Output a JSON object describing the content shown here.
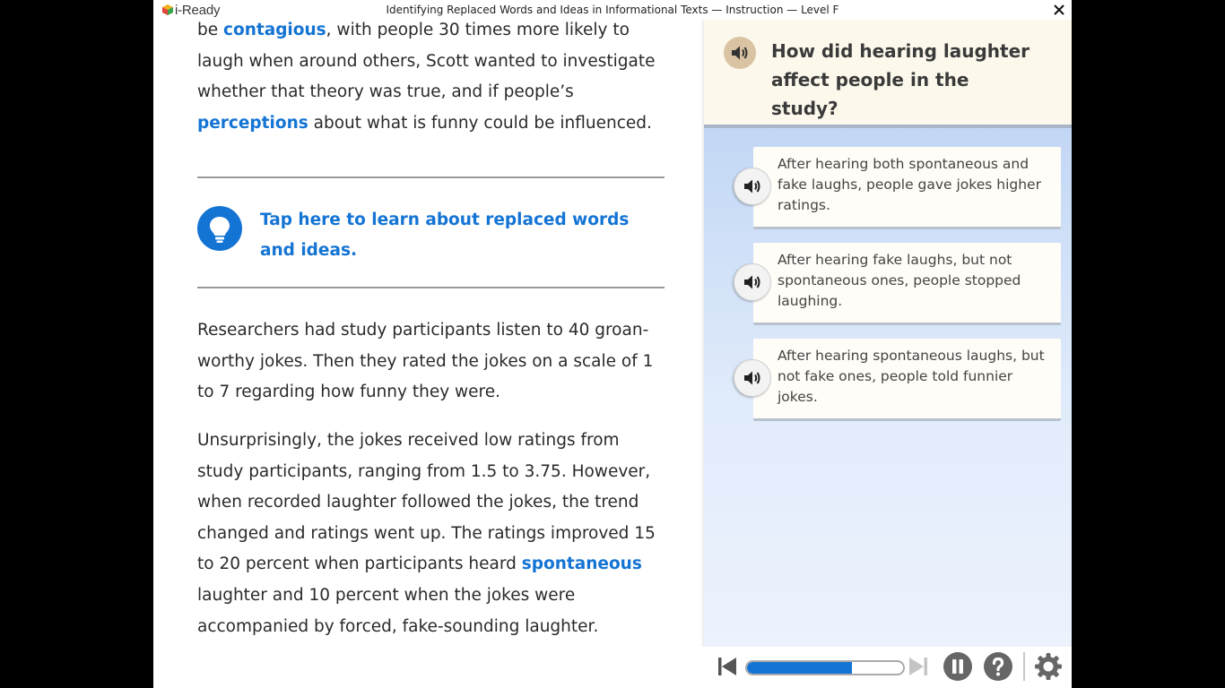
{
  "window": {
    "brand": "i-Ready",
    "title": "Identifying Replaced Words and Ideas in Informational Texts — Instruction — Level F"
  },
  "passage": {
    "p1": {
      "s1": "be ",
      "k1": "contagious",
      "s2": ", with people 30 times more likely to laugh when around others, Scott wanted to investigate whether that theory was true, and if people’s ",
      "k2": "perceptions",
      "s3": " about what is funny could be influenced."
    },
    "tip": "Tap here to learn about replaced words and ideas.",
    "p2": "Researchers had study participants listen to 40 groan-worthy jokes. Then they rated the jokes on a scale of 1 to 7 regarding how funny they were.",
    "p3": {
      "s1": "Unsurprisingly, the jokes received low ratings from study participants, ranging from 1.5 to 3.75. However, when recorded laughter followed the jokes, the trend changed and ratings went up. The ratings improved 15 to 20 percent when participants heard ",
      "k1": "spontaneous",
      "s2": " laughter and 10 percent when the jokes were accompanied by forced, fake-sounding laughter."
    }
  },
  "question": {
    "text": "How did hearing laughter affect people in the study?",
    "choices": [
      "After hearing both spontaneous and fake laughs, people gave jokes higher ratings.",
      "After hearing fake laughs, but not spontaneous ones, people stopped laughing.",
      "After hearing spontaneous laughs, but not fake ones, people told funnier jokes."
    ]
  },
  "controls": {
    "progress": 0.67
  },
  "colors": {
    "accent": "#1474d4",
    "question_bg": "#fdf8ec",
    "panel_bg": "#c9dcf6"
  }
}
